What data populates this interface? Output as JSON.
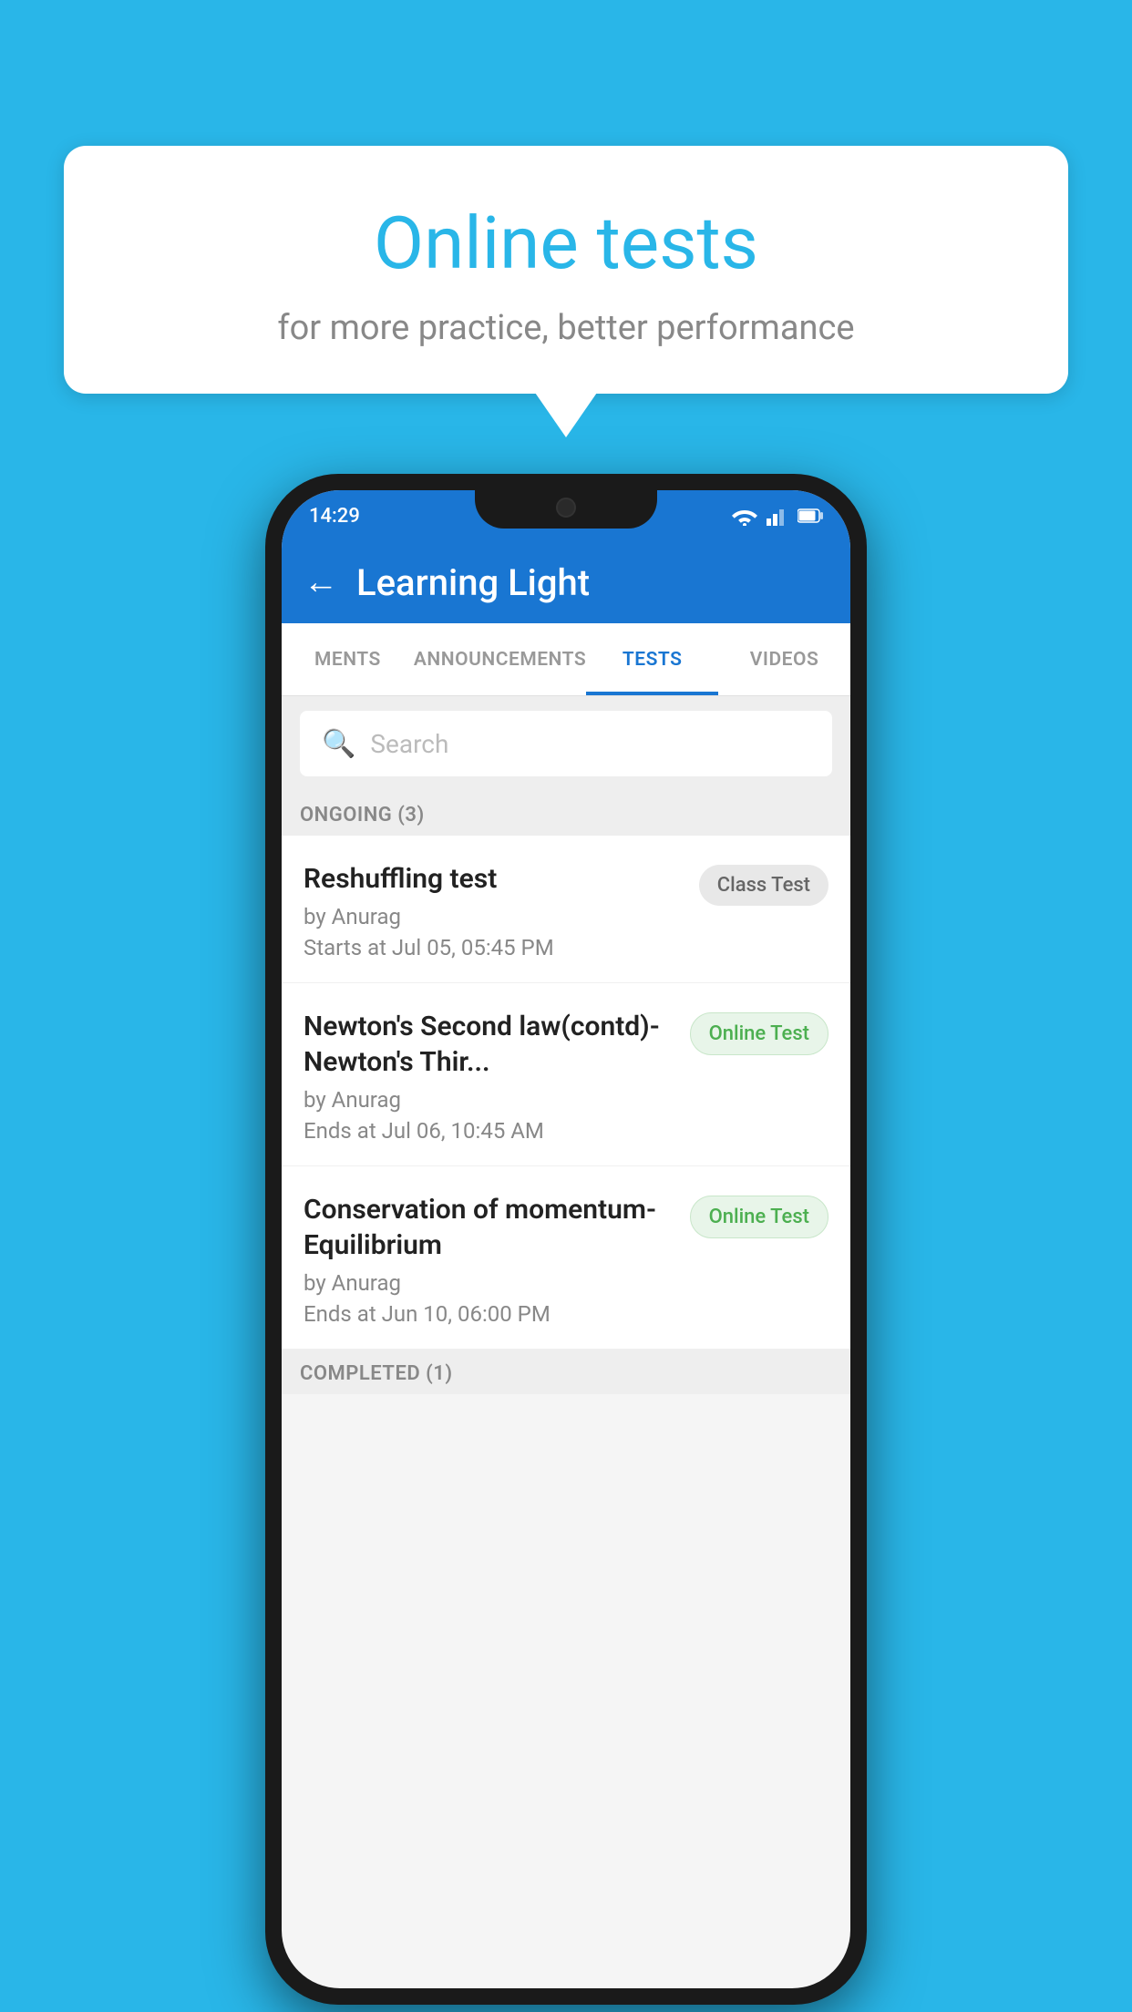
{
  "background_color": "#29B6E8",
  "bubble": {
    "title": "Online tests",
    "subtitle": "for more practice, better performance"
  },
  "phone": {
    "status_bar": {
      "time": "14:29"
    },
    "app_bar": {
      "title": "Learning Light",
      "back_label": "←"
    },
    "tabs": [
      {
        "label": "MENTS",
        "active": false
      },
      {
        "label": "ANNOUNCEMENTS",
        "active": false
      },
      {
        "label": "TESTS",
        "active": true
      },
      {
        "label": "VIDEOS",
        "active": false
      }
    ],
    "search": {
      "placeholder": "Search"
    },
    "ongoing_section": {
      "label": "ONGOING (3)"
    },
    "tests": [
      {
        "name": "Reshuffling test",
        "by": "by Anurag",
        "time": "Starts at  Jul 05, 05:45 PM",
        "badge": "Class Test",
        "badge_type": "class"
      },
      {
        "name": "Newton's Second law(contd)-Newton's Thir...",
        "by": "by Anurag",
        "time": "Ends at  Jul 06, 10:45 AM",
        "badge": "Online Test",
        "badge_type": "online"
      },
      {
        "name": "Conservation of momentum-Equilibrium",
        "by": "by Anurag",
        "time": "Ends at  Jun 10, 06:00 PM",
        "badge": "Online Test",
        "badge_type": "online"
      }
    ],
    "completed_label": "COMPLETED (1)"
  }
}
